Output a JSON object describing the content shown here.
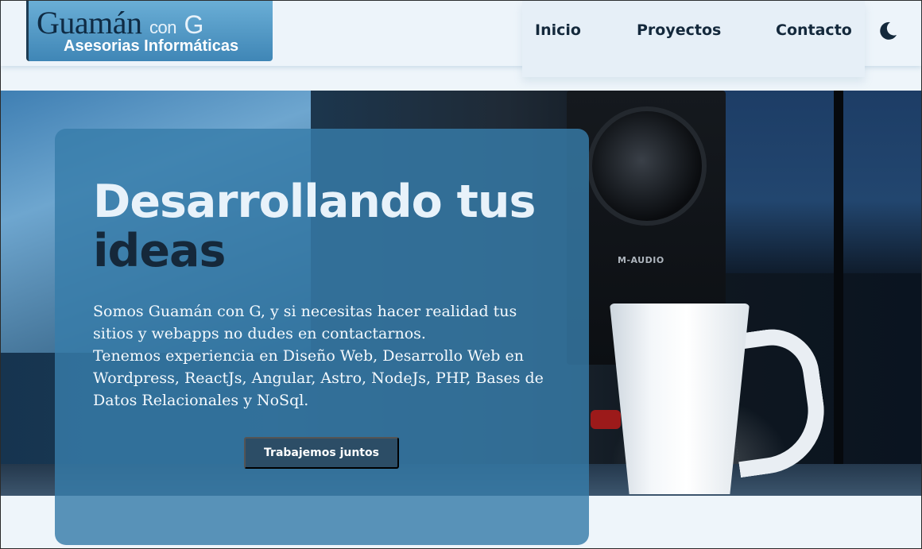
{
  "logo": {
    "name": "Guamán",
    "con": "con",
    "g": "G",
    "subtitle": "Asesorias Informáticas"
  },
  "nav": {
    "items": [
      {
        "label": "Inicio"
      },
      {
        "label": "Proyectos"
      },
      {
        "label": "Contacto"
      }
    ],
    "theme_icon": "moon-icon"
  },
  "hero": {
    "speaker_brand": "M-AUDIO",
    "title_line1": "Desarrollando tus",
    "title_line2": "ideas",
    "paragraph1": "Somos Guamán con G, y si necesitas hacer realidad tus sitios y webapps no dudes en contactarnos.",
    "paragraph2": "Tenemos experiencia en Diseño Web, Desarrollo Web en Wordpress, ReactJs, Angular, Astro, NodeJs, PHP, Bases de Datos Relacionales y NoSql.",
    "cta_label": "Trabajemos juntos"
  },
  "colors": {
    "background": "#eef5fa",
    "header": "#edf4fa",
    "card": "#377daa",
    "title_dark": "#15283a",
    "button": "#2c4d66"
  }
}
